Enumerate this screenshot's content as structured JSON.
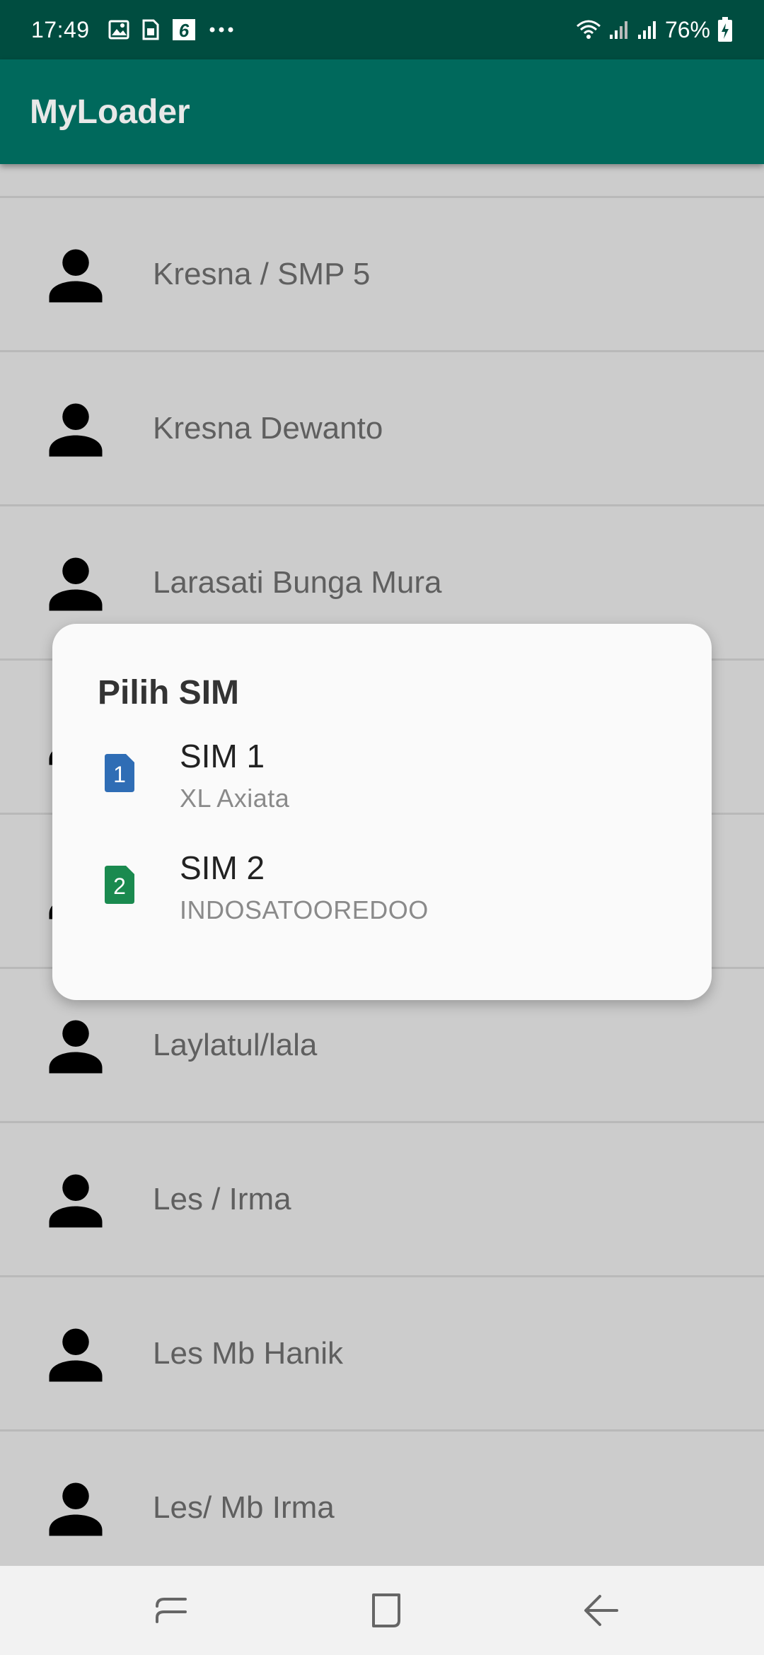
{
  "status_bar": {
    "time": "17:49",
    "left_icons": [
      "image-icon",
      "sim-card-icon",
      "app-6-icon",
      "more-dots-icon"
    ],
    "right_icons": [
      "wifi-icon",
      "signal-1-icon",
      "signal-2-icon",
      "battery-charging-icon"
    ],
    "battery": "76%"
  },
  "app_bar": {
    "title": "MyLoader"
  },
  "contacts": [
    {
      "name": "Kresna / SMP 5"
    },
    {
      "name": "Kresna Dewanto"
    },
    {
      "name": "Larasati Bunga Mura"
    },
    {
      "name": ""
    },
    {
      "name": ""
    },
    {
      "name": "Laylatul/lala"
    },
    {
      "name": "Les / Irma"
    },
    {
      "name": "Les Mb Hanik"
    },
    {
      "name": "Les/ Mb Irma"
    }
  ],
  "dialog": {
    "title": "Pilih SIM",
    "options": [
      {
        "label": "SIM 1",
        "carrier": "XL Axiata",
        "badge": "1",
        "color": "#2f6db5"
      },
      {
        "label": "SIM 2",
        "carrier": "INDOSATOOREDOO",
        "badge": "2",
        "color": "#1a8a4f"
      }
    ]
  },
  "nav_bar": {
    "buttons": [
      "recents-icon",
      "home-icon",
      "back-icon"
    ]
  },
  "colors": {
    "status_bar": "#004d40",
    "app_bar": "#00695c",
    "list_bg": "#cccccc",
    "dialog_bg": "#fafafa"
  }
}
